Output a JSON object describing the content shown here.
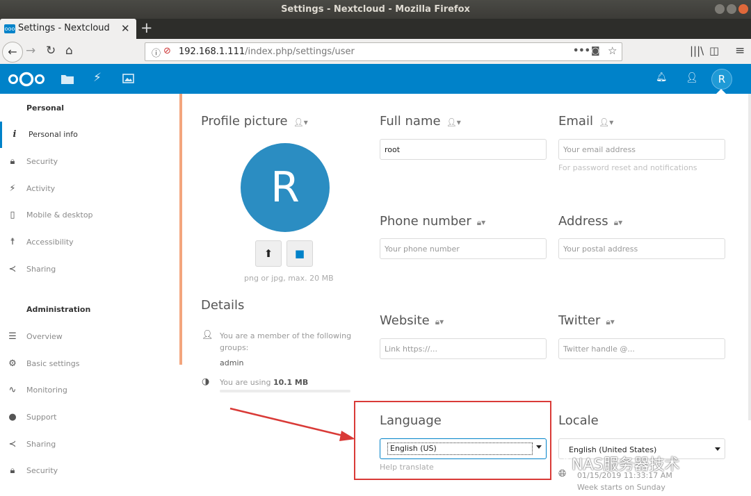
{
  "window": {
    "title": "Settings - Nextcloud - Mozilla Firefox"
  },
  "browser": {
    "tab_title": "Settings - Nextcloud",
    "url_host": "192.168.1.111",
    "url_path": "/index.php/settings/user"
  },
  "sidebar": {
    "personal_heading": "Personal",
    "personal_items": [
      {
        "label": "Personal info",
        "icon": "info-icon",
        "active": true
      },
      {
        "label": "Security",
        "icon": "lock-icon"
      },
      {
        "label": "Activity",
        "icon": "lightning-icon"
      },
      {
        "label": "Mobile & desktop",
        "icon": "phone-icon"
      },
      {
        "label": "Accessibility",
        "icon": "accessibility-icon"
      },
      {
        "label": "Sharing",
        "icon": "share-icon"
      }
    ],
    "admin_heading": "Administration",
    "admin_items": [
      {
        "label": "Overview",
        "icon": "list-icon"
      },
      {
        "label": "Basic settings",
        "icon": "gear-icon"
      },
      {
        "label": "Monitoring",
        "icon": "pulse-icon"
      },
      {
        "label": "Support",
        "icon": "chat-icon"
      },
      {
        "label": "Sharing",
        "icon": "share-icon"
      },
      {
        "label": "Security",
        "icon": "lock-icon"
      }
    ]
  },
  "header": {
    "avatar_letter": "R",
    "brand_color": "#0082c9"
  },
  "profile": {
    "picture_label": "Profile picture",
    "avatar_letter": "R",
    "picture_hint": "png or jpg, max. 20 MB",
    "details_label": "Details",
    "groups_text": "You are a member of the following groups:",
    "group_name": "admin",
    "usage_prefix": "You are using ",
    "usage_value": "10.1 MB"
  },
  "fields": {
    "fullname": {
      "label": "Full name",
      "value": "root"
    },
    "email": {
      "label": "Email",
      "placeholder": "Your email address",
      "hint": "For password reset and notifications"
    },
    "phone": {
      "label": "Phone number",
      "placeholder": "Your phone number"
    },
    "address": {
      "label": "Address",
      "placeholder": "Your postal address"
    },
    "website": {
      "label": "Website",
      "placeholder": "Link https://..."
    },
    "twitter": {
      "label": "Twitter",
      "placeholder": "Twitter handle @..."
    }
  },
  "language": {
    "label": "Language",
    "value": "English (US)",
    "help": "Help translate"
  },
  "locale": {
    "label": "Locale",
    "value": "English (United States)",
    "datetime": "01/15/2019 11:33:17 AM",
    "week": "Week starts on Sunday"
  },
  "watermark": "NAS服务器技术",
  "annotation_color": "#d93a37"
}
